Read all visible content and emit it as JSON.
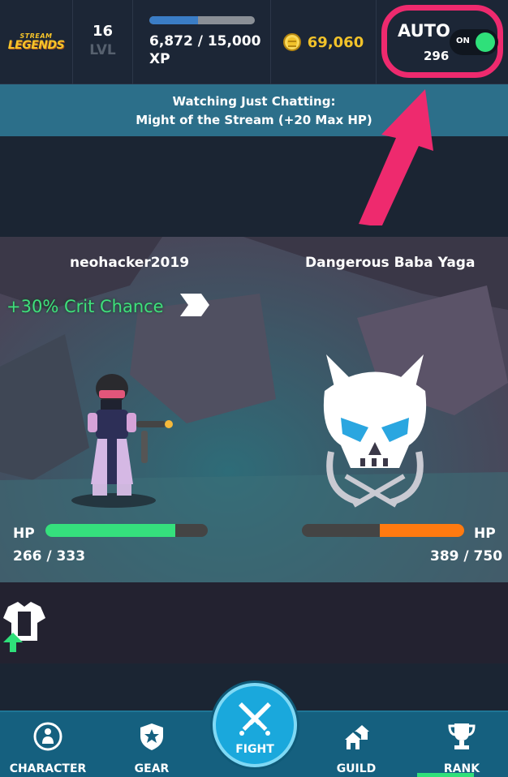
{
  "header": {
    "logo": {
      "line1": "STREAM",
      "line2": "LEGENDS"
    },
    "level": {
      "value": "16",
      "label": "LVL"
    },
    "xp": {
      "current": "6,872",
      "max": "15,000",
      "text": "6,872 / 15,000",
      "label": "XP",
      "progress": 0.458
    },
    "gold": {
      "value": "69,060",
      "icon": "gold-coin-icon"
    },
    "auto": {
      "label": "AUTO",
      "count": "296",
      "toggle_label": "ON",
      "enabled": true
    }
  },
  "buff": {
    "line1": "Watching Just Chatting:",
    "line2": "Might of the Stream (+20 Max HP)"
  },
  "battle": {
    "player": {
      "name": "neohacker2019",
      "hp_label": "HP",
      "hp_text": "266 / 333",
      "hp_current": 266,
      "hp_max": 333
    },
    "enemy": {
      "name": "Dangerous Baba Yaga",
      "hp_label": "HP",
      "hp_text": "389 / 750",
      "hp_current": 389,
      "hp_max": 750
    },
    "buff_text": "+30% Crit Chance"
  },
  "nav": {
    "items": [
      {
        "label": "CHARACTER",
        "icon": "character-icon"
      },
      {
        "label": "GEAR",
        "icon": "gear-shield-icon"
      },
      {
        "label": "FIGHT",
        "icon": "crossed-swords-icon"
      },
      {
        "label": "GUILD",
        "icon": "guild-house-icon"
      },
      {
        "label": "RANK",
        "icon": "trophy-icon"
      }
    ]
  },
  "colors": {
    "accent_pink": "#ee2a6e",
    "hp_player": "#35e07d",
    "hp_enemy": "#ff7a10",
    "gold": "#f1c22a",
    "nav_bg": "#15607f",
    "banner_bg": "#2c6f8a"
  }
}
